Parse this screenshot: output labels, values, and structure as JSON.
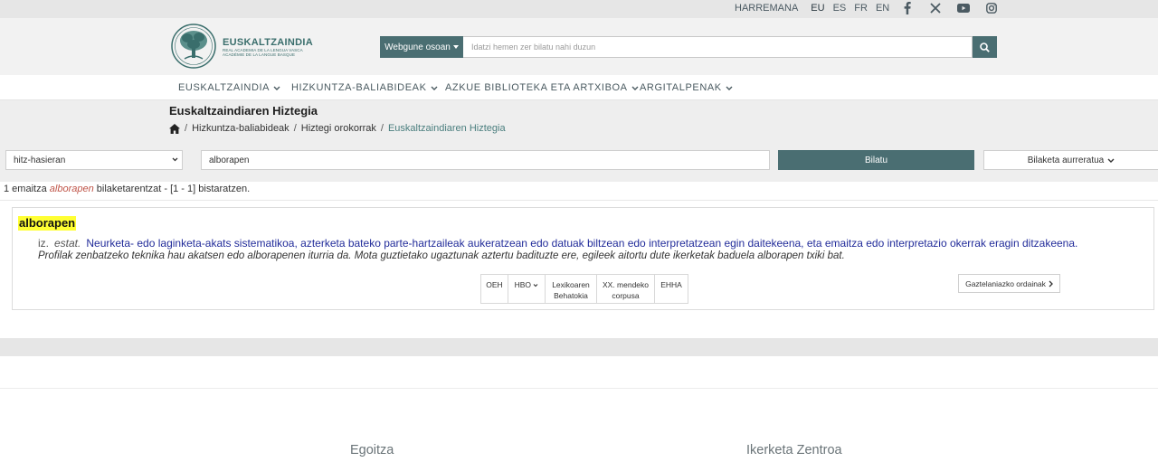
{
  "topbar": {
    "contact": "HARREMANA",
    "languages": [
      "EU",
      "ES",
      "FR",
      "EN"
    ],
    "active_language": "EU",
    "social_icons": [
      "facebook-icon",
      "x-icon",
      "youtube-icon",
      "instagram-icon"
    ]
  },
  "brand": {
    "name": "EUSKALTZAINDIA",
    "sub_es": "REAL ACADEMIA DE LA LENGUA VASCA",
    "sub_fr": "ACADÉMIE DE LA LANGUE BASQUE",
    "accent": "#3a6e6c"
  },
  "site_search": {
    "scope": "Webgune osoan",
    "placeholder": "Idatzi hemen zer bilatu nahi duzun",
    "button_icon": "search-icon",
    "button_color": "#4a6e72"
  },
  "nav": {
    "items": [
      {
        "label": "EUSKALTZAINDIA"
      },
      {
        "label": "HIZKUNTZA-BALIABIDEAK"
      },
      {
        "label": "AZKUE BIBLIOTEKA ETA ARTXIBOA"
      },
      {
        "label": "ARGITALPENAK"
      }
    ]
  },
  "page": {
    "title": "Euskaltzaindiaren Hiztegia",
    "breadcrumb": [
      "Hizkuntza-baliabideak",
      "Hiztegi orokorrak",
      "Euskaltzaindiaren Hiztegia"
    ]
  },
  "dict_search": {
    "mode": "hitz-hasieran",
    "term": "alborapen",
    "search_label": "Bilatu",
    "advanced_label": "Bilaketa aurreratua"
  },
  "results": {
    "count": "1",
    "text_before": " emaitza ",
    "term": "alborapen",
    "text_after": " bilaketarentzat - [1 - 1] bistaratzen."
  },
  "entry": {
    "headword": "alborapen",
    "pos": "iz.",
    "domain": "estat.",
    "definition": "Neurketa- edo laginketa-akats sistematikoa, azterketa bateko parte-hartzaileak aukeratzean edo datuak biltzean edo interpretatzean egin daitekeena, eta emaitza edo interpretazio okerrak eragin ditzakeena.",
    "example": "Profilak zenbatzeko teknika hau akatsen edo alborapenen iturria da. Mota guztietako ugaztunak aztertu badituzte ere, egileek aitortu dute ikerketak baduela alborapen txiki bat.",
    "refs": {
      "oeh": "OEH",
      "hbo": "HBO",
      "lex1": "Lexikoaren",
      "lex2": "Behatokia",
      "xx1": "XX. mendeko",
      "xx2": "corpusa",
      "ehha": "EHHA"
    },
    "translations_label": "Gaztelaniazko ordainak"
  },
  "footer": {
    "col1": "Egoitza",
    "col2": "Ikerketa Zentroa"
  }
}
